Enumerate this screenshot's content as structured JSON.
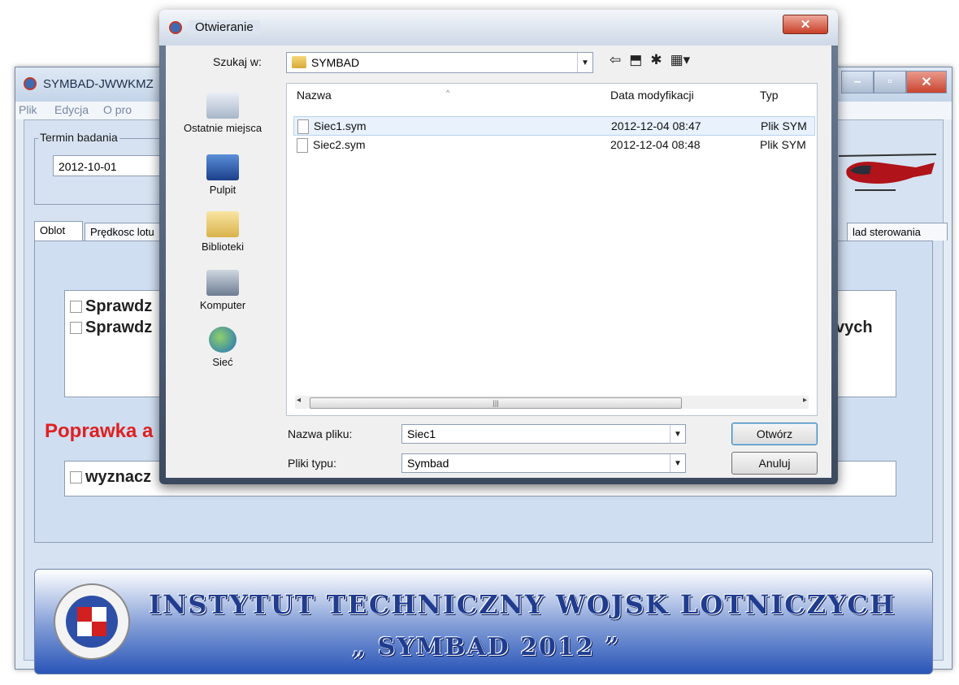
{
  "main_window": {
    "title": "SYMBAD-JWWKMZ",
    "menu": [
      "Plik",
      "Edycja",
      "O pro"
    ],
    "termin_group_label": "Termin badania",
    "date_value": "2012-10-01",
    "tabs": [
      "Oblot",
      "Prędkosc lotu",
      "lad sterowania"
    ],
    "check_items": [
      "Sprawdz",
      "Sprawdz"
    ],
    "check_items_tail": "vych",
    "poprawka_label": "Poprawka a",
    "wyznacz_item": "wyznacz",
    "banner_line1": "INSTYTUT TECHNICZNY WOJSK LOTNICZYCH",
    "banner_line2": "„ SYMBAD 2012 ”",
    "logo_text": "INSTYTUT TECHNICZNY WOJSK LOTNICZYCH"
  },
  "dialog": {
    "title": "Otwieranie",
    "lookin_label": "Szukaj w:",
    "lookin_value": "SYMBAD",
    "places": [
      "Ostatnie miejsca",
      "Pulpit",
      "Biblioteki",
      "Komputer",
      "Sieć"
    ],
    "columns": [
      "Nazwa",
      "Data modyfikacji",
      "Typ"
    ],
    "files": [
      {
        "name": "Siec1.sym",
        "date": "2012-12-04 08:47",
        "type": "Plik SYM"
      },
      {
        "name": "Siec2.sym",
        "date": "2012-12-04 08:48",
        "type": "Plik SYM"
      }
    ],
    "filename_label": "Nazwa pliku:",
    "filename_value": "Siec1",
    "filetype_label": "Pliki typu:",
    "filetype_value": "Symbad",
    "open_button": "Otwórz",
    "cancel_button": "Anuluj"
  },
  "icons": {
    "close": "close-icon",
    "back": "back-arrow-icon",
    "up": "up-folder-icon",
    "new_folder": "new-folder-icon",
    "view_menu": "view-menu-icon"
  },
  "colors": {
    "accent_red": "#e02020",
    "banner_blue": "#1f3c8f"
  }
}
